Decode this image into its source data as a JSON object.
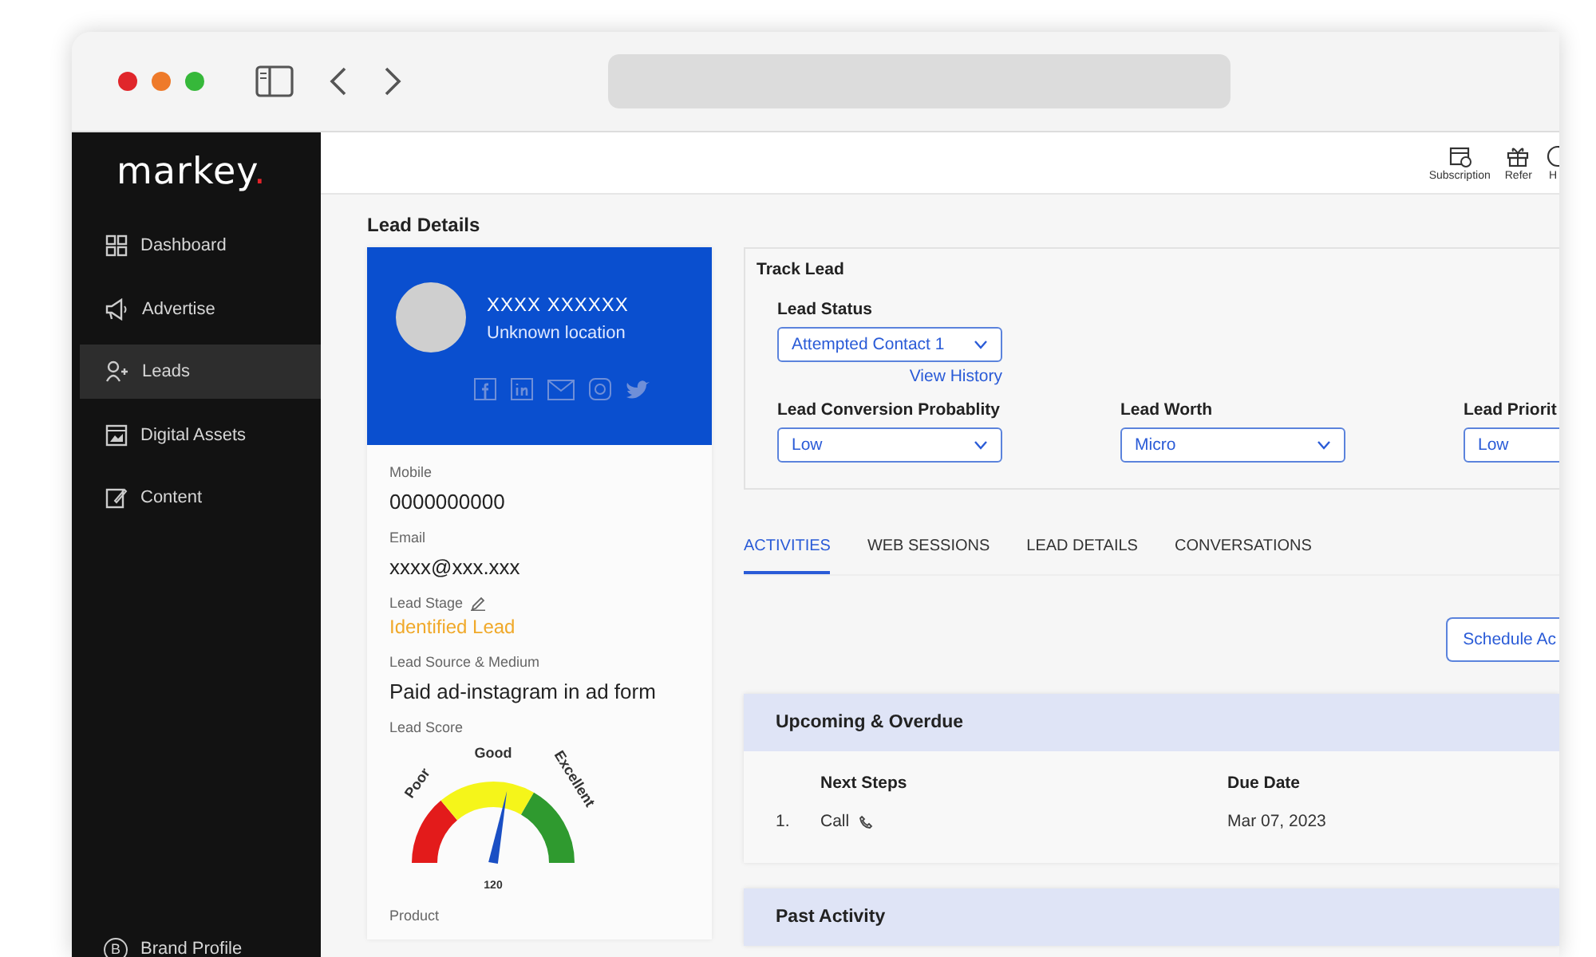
{
  "sidebar": {
    "logo": {
      "text": "markey",
      "dot": "."
    },
    "items": [
      {
        "label": "Dashboard",
        "selected": false
      },
      {
        "label": "Advertise",
        "selected": false
      },
      {
        "label": "Leads",
        "selected": true
      },
      {
        "label": "Digital Assets",
        "selected": false
      },
      {
        "label": "Content",
        "selected": false
      }
    ],
    "footer": {
      "letter": "B",
      "label": "Brand Profile"
    }
  },
  "header": {
    "actions": [
      {
        "label": "Subscription"
      },
      {
        "label": "Refer"
      },
      {
        "label": "H"
      }
    ]
  },
  "page_title": "Lead Details",
  "lead": {
    "name": "XXXX XXXXXX",
    "location": "Unknown location",
    "fields": [
      {
        "kind": "text",
        "label": "Mobile",
        "value": "0000000000"
      },
      {
        "kind": "text",
        "label": "Email",
        "value": "xxxx@xxx.xxx"
      },
      {
        "kind": "stage",
        "label": "Lead Stage",
        "value": "Identified Lead"
      },
      {
        "kind": "text",
        "label": "Lead Source & Medium",
        "value": "Paid ad-instagram in ad form"
      },
      {
        "kind": "score",
        "label": "Lead Score",
        "value": "120",
        "bands": [
          "Poor",
          "Good",
          "Excellent"
        ]
      },
      {
        "kind": "label",
        "label": "Product"
      }
    ]
  },
  "track": {
    "title": "Track Lead",
    "status": {
      "label": "Lead Status",
      "value": "Attempted Contact 1",
      "link": "View History"
    },
    "selects": [
      {
        "label": "Lead Conversion Probablity",
        "value": "Low"
      },
      {
        "label": "Lead Worth",
        "value": "Micro"
      },
      {
        "label": "Lead Priorit",
        "value": "Low"
      }
    ]
  },
  "tabs": [
    {
      "label": "ACTIVITIES",
      "selected": true
    },
    {
      "label": "WEB SESSIONS",
      "selected": false
    },
    {
      "label": "LEAD DETAILS",
      "selected": false
    },
    {
      "label": "CONVERSATIONS",
      "selected": false
    }
  ],
  "schedule_button": "Schedule Ac",
  "upcoming": {
    "title": "Upcoming & Overdue",
    "columns": [
      "Next Steps",
      "Due Date"
    ],
    "rows": [
      {
        "index": "1.",
        "step": "Call",
        "due": "Mar 07, 2023"
      }
    ]
  },
  "past": {
    "title": "Past Activity"
  }
}
